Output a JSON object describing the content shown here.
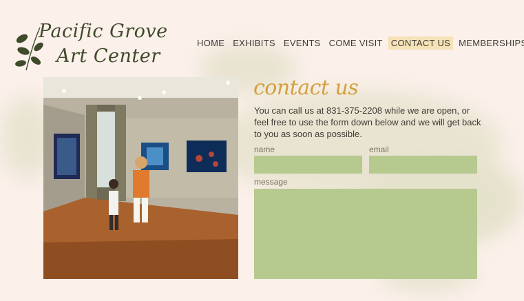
{
  "brand": {
    "line1": "Pacific Grove",
    "line2": "Art Center"
  },
  "nav": {
    "items": [
      {
        "label": "HOME"
      },
      {
        "label": "EXHIBITS"
      },
      {
        "label": "EVENTS"
      },
      {
        "label": "COME VISIT"
      },
      {
        "label": "CONTACT US",
        "active": true
      },
      {
        "label": "MEMBERSHIPS"
      }
    ]
  },
  "contact": {
    "heading": "contact us",
    "intro": "You can call us at 831-375-2208 while we are open, or feel free to use the form down below and we will get back to you as soon as possible.",
    "name_label": "name",
    "email_label": "email",
    "message_label": "message"
  },
  "colors": {
    "background": "#fbf0ea",
    "accent_gold": "#d3a03b",
    "field_green": "#b6c98f",
    "active_nav": "#f5e2b6"
  }
}
